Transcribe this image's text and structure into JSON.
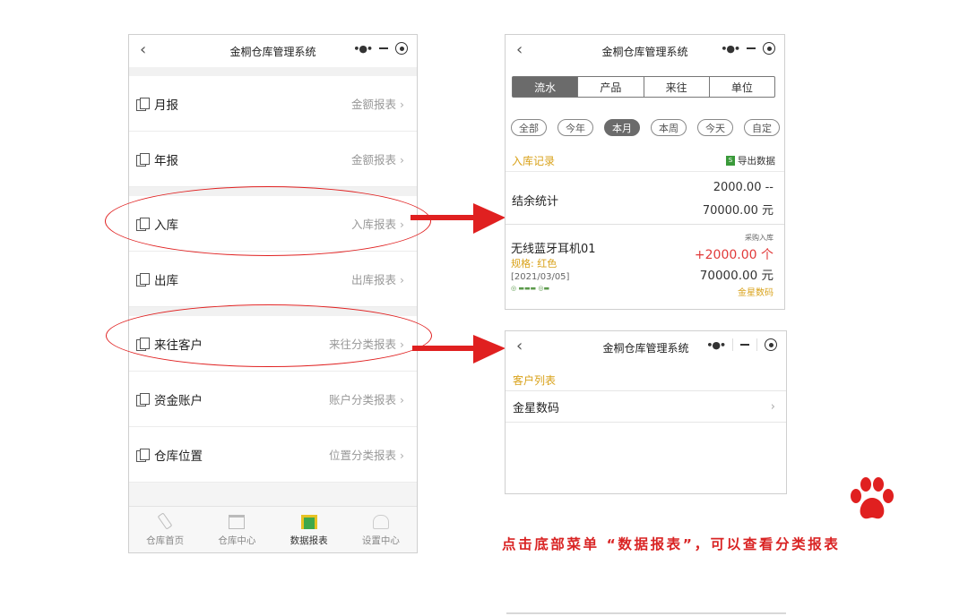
{
  "left": {
    "title": "金桐仓库管理系统",
    "rows": [
      {
        "label": "月报",
        "right": "金额报表"
      },
      {
        "label": "年报",
        "right": "金额报表"
      },
      {
        "label": "入库",
        "right": "入库报表"
      },
      {
        "label": "出库",
        "right": "出库报表"
      },
      {
        "label": "来往客户",
        "right": "来往分类报表"
      },
      {
        "label": "资金账户",
        "right": "账户分类报表"
      },
      {
        "label": "仓库位置",
        "right": "位置分类报表"
      }
    ],
    "tabs": [
      {
        "label": "仓库首页"
      },
      {
        "label": "仓库中心"
      },
      {
        "label": "数据报表"
      },
      {
        "label": "设置中心"
      }
    ]
  },
  "right_top": {
    "title": "金桐仓库管理系统",
    "segments": [
      "流水",
      "产品",
      "来往",
      "单位"
    ],
    "active_segment": "流水",
    "pills": [
      "全部",
      "今年",
      "本月",
      "本周",
      "今天",
      "自定"
    ],
    "active_pill": "本月",
    "section_title": "入库记录",
    "export_label": "导出数据",
    "summary": {
      "label": "结余统计",
      "qty": "2000.00 --",
      "amount": "70000.00 元"
    },
    "record": {
      "kind": "采购入库",
      "name": "无线蓝牙耳机01",
      "spec": "规格: 红色",
      "date": "[2021/03/05]",
      "qty": "+2000.00 个",
      "amount": "70000.00 元",
      "shop": "金星数码"
    }
  },
  "right_bottom": {
    "title": "金桐仓库管理系统",
    "section_title": "客户列表",
    "customer": "金星数码"
  },
  "caption": "点击底部菜单 “数据报表”，可以查看分类报表",
  "colors": {
    "accent_red": "#e02020",
    "gold": "#d9a21a",
    "segment_active": "#6b6b6b"
  }
}
